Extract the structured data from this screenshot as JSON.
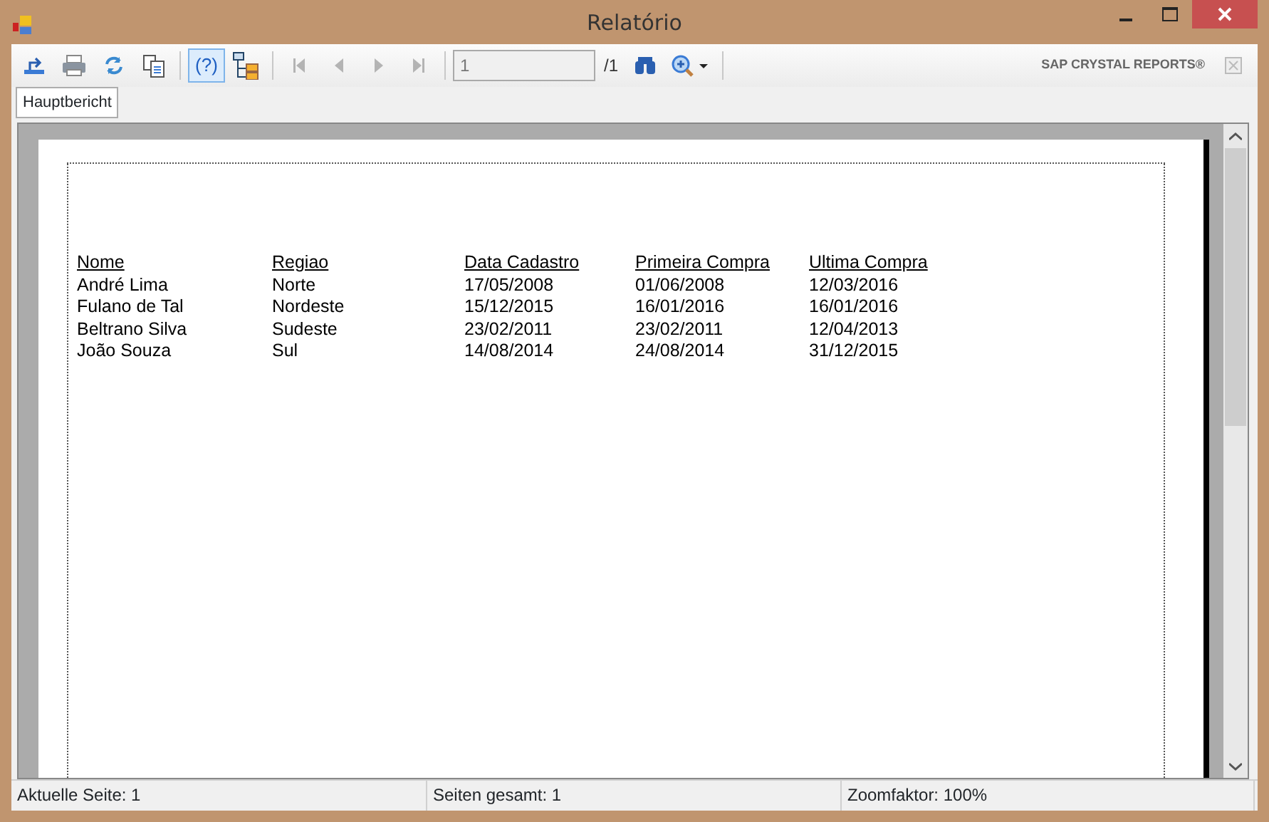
{
  "window": {
    "title": "Relatório"
  },
  "toolbar": [
    {
      "kind": "export"
    },
    {
      "kind": "print"
    },
    {
      "kind": "refresh"
    },
    {
      "kind": "copy"
    },
    {
      "kind": "sep"
    },
    {
      "kind": "help",
      "label": "(?)",
      "selected": true
    },
    {
      "kind": "tree",
      "selected": false
    },
    {
      "kind": "sep"
    },
    {
      "kind": "first",
      "disabled": true
    },
    {
      "kind": "prev",
      "disabled": true
    },
    {
      "kind": "next",
      "disabled": true
    },
    {
      "kind": "last",
      "disabled": true
    },
    {
      "kind": "sep"
    }
  ],
  "page_field": {
    "value": "1",
    "total": "/1"
  },
  "brand": "SAP CRYSTAL REPORTS®",
  "tabs": [
    {
      "label": "Hauptbericht",
      "selected": true
    }
  ],
  "report": {
    "columns": [
      "Nome",
      "Regiao",
      "Data Cadastro",
      "Primeira Compra",
      "Ultima Compra"
    ],
    "rows": [
      [
        "André Lima",
        "Norte",
        "17/05/2008",
        "01/06/2008",
        "12/03/2016"
      ],
      [
        "Fulano de Tal",
        "Nordeste",
        "15/12/2015",
        "16/01/2016",
        "16/01/2016"
      ],
      [
        "Beltrano Silva",
        "Sudeste",
        "23/02/2011",
        "23/02/2011",
        "12/04/2013"
      ],
      [
        "João Souza",
        "Sul",
        "14/08/2014",
        "24/08/2014",
        "31/12/2015"
      ]
    ]
  },
  "status_bar": [
    "Aktuelle Seite: 1",
    "Seiten gesamt: 1",
    "Zoomfaktor: 100%"
  ]
}
